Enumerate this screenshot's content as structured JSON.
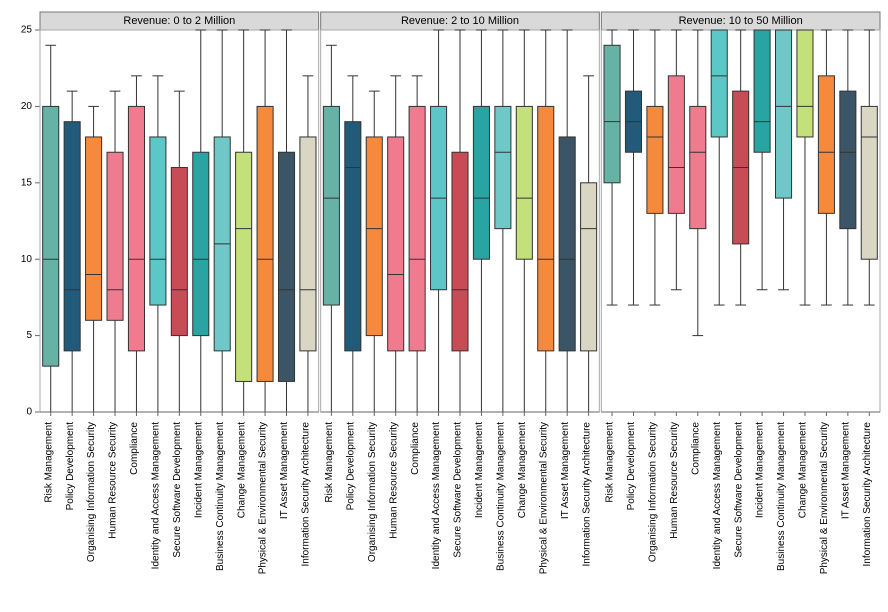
{
  "chart_data": {
    "type": "box",
    "ylim": [
      0,
      25
    ],
    "ylabel": "",
    "xlabel": "",
    "categories": [
      "Risk Management",
      "Policy Development",
      "Organising Information Security",
      "Human Resource Security",
      "Compliance",
      "Identity and Access Management",
      "Secure Software Development",
      "Incident Management",
      "Business Continuity Management",
      "Change Management",
      "Physical & Environmental Security",
      "IT Asset Management",
      "Information Security Architecture"
    ],
    "colors": {
      "Risk Management": "#66b2a5",
      "Policy Development": "#225a7a",
      "Organising Information Security": "#f58a3c",
      "Human Resource Security": "#f07b8f",
      "Compliance": "#f07b8f",
      "Identity and Access Management": "#5bc7c7",
      "Secure Software Development": "#c84c55",
      "Incident Management": "#2aa3a3",
      "Business Continuity Management": "#6ec8c8",
      "Change Management": "#c4e07a",
      "Physical & Environmental Security": "#f58a3c",
      "IT Asset Management": "#3b5566",
      "Information Security Architecture": "#d9d6c3"
    },
    "panels": [
      {
        "title": "Revenue: 0 to 2 Million",
        "series": [
          {
            "name": "Risk Management",
            "low": 0,
            "q1": 3,
            "median": 10,
            "q3": 20,
            "high": 24
          },
          {
            "name": "Policy Development",
            "low": 0,
            "q1": 4,
            "median": 8,
            "q3": 19,
            "high": 21
          },
          {
            "name": "Organising Information Security",
            "low": 0,
            "q1": 6,
            "median": 9,
            "q3": 18,
            "high": 20
          },
          {
            "name": "Human Resource Security",
            "low": 0,
            "q1": 6,
            "median": 8,
            "q3": 17,
            "high": 21
          },
          {
            "name": "Compliance",
            "low": 0,
            "q1": 4,
            "median": 10,
            "q3": 20,
            "high": 22
          },
          {
            "name": "Identity and Access Management",
            "low": 0,
            "q1": 7,
            "median": 10,
            "q3": 18,
            "high": 22
          },
          {
            "name": "Secure Software Development",
            "low": 0,
            "q1": 5,
            "median": 8,
            "q3": 16,
            "high": 21
          },
          {
            "name": "Incident Management",
            "low": 0,
            "q1": 5,
            "median": 10,
            "q3": 17,
            "high": 25
          },
          {
            "name": "Business Continuity Management",
            "low": 0,
            "q1": 4,
            "median": 11,
            "q3": 18,
            "high": 25
          },
          {
            "name": "Change Management",
            "low": 0,
            "q1": 2,
            "median": 12,
            "q3": 17,
            "high": 25
          },
          {
            "name": "Physical & Environmental Security",
            "low": 0,
            "q1": 2,
            "median": 10,
            "q3": 20,
            "high": 25
          },
          {
            "name": "IT Asset Management",
            "low": 0,
            "q1": 2,
            "median": 8,
            "q3": 17,
            "high": 25
          },
          {
            "name": "Information Security Architecture",
            "low": 0,
            "q1": 4,
            "median": 8,
            "q3": 18,
            "high": 22
          }
        ]
      },
      {
        "title": "Revenue: 2 to 10 Million",
        "series": [
          {
            "name": "Risk Management",
            "low": 0,
            "q1": 7,
            "median": 14,
            "q3": 20,
            "high": 24
          },
          {
            "name": "Policy Development",
            "low": 0,
            "q1": 4,
            "median": 16,
            "q3": 19,
            "high": 22
          },
          {
            "name": "Organising Information Security",
            "low": 0,
            "q1": 5,
            "median": 12,
            "q3": 18,
            "high": 21
          },
          {
            "name": "Human Resource Security",
            "low": 0,
            "q1": 4,
            "median": 9,
            "q3": 18,
            "high": 22
          },
          {
            "name": "Compliance",
            "low": 0,
            "q1": 4,
            "median": 10,
            "q3": 20,
            "high": 22
          },
          {
            "name": "Identity and Access Management",
            "low": 0,
            "q1": 8,
            "median": 14,
            "q3": 20,
            "high": 25
          },
          {
            "name": "Secure Software Development",
            "low": 0,
            "q1": 4,
            "median": 8,
            "q3": 17,
            "high": 25
          },
          {
            "name": "Incident Management",
            "low": 0,
            "q1": 10,
            "median": 14,
            "q3": 20,
            "high": 25
          },
          {
            "name": "Business Continuity Management",
            "low": 0,
            "q1": 12,
            "median": 17,
            "q3": 20,
            "high": 25
          },
          {
            "name": "Change Management",
            "low": 0,
            "q1": 10,
            "median": 14,
            "q3": 20,
            "high": 25
          },
          {
            "name": "Physical & Environmental Security",
            "low": 0,
            "q1": 4,
            "median": 10,
            "q3": 20,
            "high": 25
          },
          {
            "name": "IT Asset Management",
            "low": 0,
            "q1": 4,
            "median": 10,
            "q3": 18,
            "high": 25
          },
          {
            "name": "Information Security Architecture",
            "low": 0,
            "q1": 4,
            "median": 12,
            "q3": 15,
            "high": 22
          }
        ]
      },
      {
        "title": "Revenue: 10 to 50 Million",
        "series": [
          {
            "name": "Risk Management",
            "low": 7,
            "q1": 15,
            "median": 19,
            "q3": 24,
            "high": 25
          },
          {
            "name": "Policy Development",
            "low": 7,
            "q1": 17,
            "median": 19,
            "q3": 21,
            "high": 25
          },
          {
            "name": "Organising Information Security",
            "low": 7,
            "q1": 13,
            "median": 18,
            "q3": 20,
            "high": 25
          },
          {
            "name": "Human Resource Security",
            "low": 8,
            "q1": 13,
            "median": 16,
            "q3": 22,
            "high": 25
          },
          {
            "name": "Compliance",
            "low": 5,
            "q1": 12,
            "median": 17,
            "q3": 20,
            "high": 25
          },
          {
            "name": "Identity and Access Management",
            "low": 7,
            "q1": 18,
            "median": 22,
            "q3": 25,
            "high": 25
          },
          {
            "name": "Secure Software Development",
            "low": 7,
            "q1": 11,
            "median": 16,
            "q3": 21,
            "high": 25
          },
          {
            "name": "Incident Management",
            "low": 8,
            "q1": 17,
            "median": 19,
            "q3": 25,
            "high": 25
          },
          {
            "name": "Business Continuity Management",
            "low": 8,
            "q1": 14,
            "median": 20,
            "q3": 25,
            "high": 25
          },
          {
            "name": "Change Management",
            "low": 7,
            "q1": 18,
            "median": 20,
            "q3": 25,
            "high": 25
          },
          {
            "name": "Physical & Environmental Security",
            "low": 7,
            "q1": 13,
            "median": 17,
            "q3": 22,
            "high": 25
          },
          {
            "name": "IT Asset Management",
            "low": 7,
            "q1": 12,
            "median": 17,
            "q3": 21,
            "high": 25
          },
          {
            "name": "Information Security Architecture",
            "low": 7,
            "q1": 10,
            "median": 18,
            "q3": 20,
            "high": 25
          }
        ]
      }
    ]
  }
}
